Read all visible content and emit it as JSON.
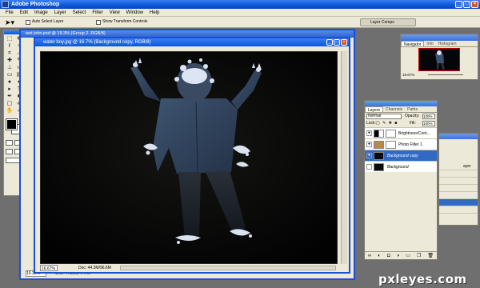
{
  "app": {
    "title": "Adobe Photoshop",
    "window_buttons": [
      "_",
      "□",
      "×"
    ]
  },
  "menu": [
    "File",
    "Edit",
    "Image",
    "Layer",
    "Select",
    "Filter",
    "View",
    "Window",
    "Help"
  ],
  "options_bar": {
    "auto_select_label": "Auto Select Layer",
    "show_transform_label": "Show Transform Controls",
    "presets_label": "Layer Comps"
  },
  "back_document": {
    "title": "wet john.psd @ 19.3% (Group 2, RGB/8)",
    "zoom": "19.33%",
    "doc_size": "Doc: 44.3M/247.7M"
  },
  "main_document": {
    "title": "water boy.jpg @ 16.7% (Background copy, RGB/8)",
    "zoom": "16.67%",
    "doc_size": "Doc: 44.3M/96.6M"
  },
  "navigator": {
    "tabs": [
      "Navigator",
      "Info",
      "Histogram"
    ],
    "zoom": "16.67%"
  },
  "layers_panel": {
    "tabs": [
      "Layers",
      "Channels",
      "Paths"
    ],
    "blend_mode": "Normal",
    "opacity_label": "Opacity:",
    "opacity_value": "100%",
    "lock_label": "Lock:",
    "fill_label": "Fill:",
    "fill_value": "100%",
    "layers": [
      {
        "name": "Brightness/Cont...",
        "type": "adjustment",
        "selected": false
      },
      {
        "name": "Photo Filter 1",
        "type": "adjustment",
        "selected": false
      },
      {
        "name": "Background copy",
        "type": "pixel",
        "selected": true
      },
      {
        "name": "Background",
        "type": "pixel",
        "selected": false
      }
    ],
    "footer_icons": [
      "link-icon",
      "fx-icon",
      "mask-icon",
      "adjustment-icon",
      "folder-icon",
      "new-layer-icon",
      "trash-icon"
    ]
  },
  "history_panel": {
    "rows": [
      "ayer",
      "",
      "",
      "",
      "",
      "",
      "",
      "",
      "",
      ""
    ]
  },
  "watermark": "pxleyes.com",
  "colors": {
    "titlebar": "#0b56d8",
    "selected_layer": "#316ac5",
    "chrome": "#ece9d8"
  }
}
